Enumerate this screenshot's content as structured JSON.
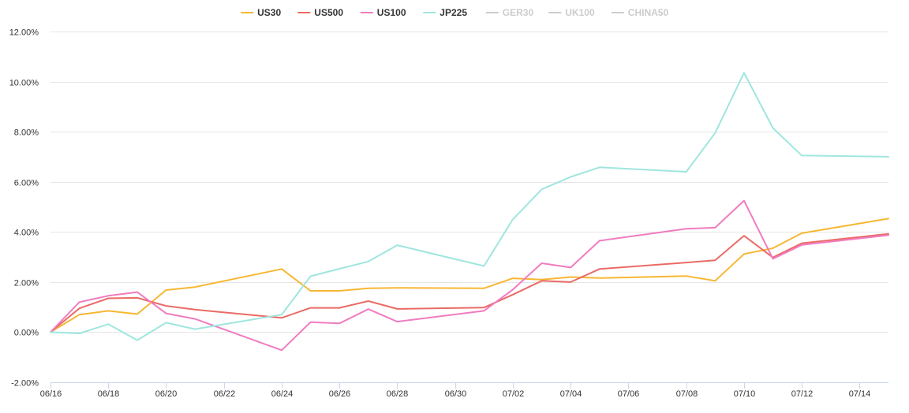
{
  "chart_data": {
    "type": "line",
    "title": "",
    "xlabel": "",
    "ylabel": "",
    "ylim": [
      -2,
      12
    ],
    "yticks": [
      -2,
      0,
      2,
      4,
      6,
      8,
      10,
      12
    ],
    "ytick_labels": [
      "-2.00%",
      "0.00%",
      "2.00%",
      "4.00%",
      "6.00%",
      "8.00%",
      "10.00%",
      "12.00%"
    ],
    "xlim": [
      "2021-06-16",
      "2021-07-15"
    ],
    "xticks": [
      "2021-06-16",
      "2021-06-18",
      "2021-06-20",
      "2021-06-22",
      "2021-06-24",
      "2021-06-26",
      "2021-06-28",
      "2021-06-30",
      "2021-07-02",
      "2021-07-04",
      "2021-07-06",
      "2021-07-08",
      "2021-07-10",
      "2021-07-12",
      "2021-07-14"
    ],
    "xtick_labels": [
      "06/16",
      "06/18",
      "06/20",
      "06/22",
      "06/24",
      "06/26",
      "06/28",
      "06/30",
      "07/02",
      "07/04",
      "07/06",
      "07/08",
      "07/10",
      "07/12",
      "07/14"
    ],
    "grid": true,
    "legend_position": "top",
    "x": [
      "2021-06-16",
      "2021-06-17",
      "2021-06-18",
      "2021-06-19",
      "2021-06-20",
      "2021-06-21",
      "2021-06-24",
      "2021-06-25",
      "2021-06-26",
      "2021-06-27",
      "2021-06-28",
      "2021-07-01",
      "2021-07-02",
      "2021-07-03",
      "2021-07-04",
      "2021-07-05",
      "2021-07-08",
      "2021-07-09",
      "2021-07-10",
      "2021-07-11",
      "2021-07-12",
      "2021-07-15"
    ],
    "series": [
      {
        "name": "US30",
        "color": "#f7b733",
        "visible": true,
        "values": [
          0.0,
          0.7,
          0.85,
          0.72,
          1.68,
          1.8,
          2.52,
          1.65,
          1.65,
          1.75,
          1.77,
          1.75,
          2.15,
          2.1,
          2.2,
          2.16,
          2.24,
          2.05,
          3.12,
          3.35,
          3.95,
          4.53
        ]
      },
      {
        "name": "US500",
        "color": "#ea6b66",
        "visible": true,
        "values": [
          0.0,
          0.95,
          1.35,
          1.37,
          1.05,
          0.9,
          0.57,
          0.97,
          0.97,
          1.24,
          0.93,
          0.98,
          1.5,
          2.05,
          2.0,
          2.52,
          2.78,
          2.87,
          3.85,
          2.98,
          3.55,
          3.92
        ]
      },
      {
        "name": "US100",
        "color": "#f07cc0",
        "visible": true,
        "values": [
          0.0,
          1.2,
          1.45,
          1.6,
          0.75,
          0.53,
          -0.72,
          0.4,
          0.35,
          0.92,
          0.42,
          0.85,
          1.7,
          2.75,
          2.58,
          3.65,
          4.13,
          4.17,
          5.25,
          2.93,
          3.48,
          3.87
        ]
      },
      {
        "name": "JP225",
        "color": "#9fe6de",
        "visible": true,
        "values": [
          0.0,
          -0.05,
          0.32,
          -0.32,
          0.38,
          0.12,
          0.7,
          2.23,
          2.53,
          2.82,
          3.47,
          2.64,
          4.5,
          5.7,
          6.2,
          6.58,
          6.4,
          7.95,
          10.35,
          8.15,
          7.05,
          7.0
        ]
      },
      {
        "name": "GER30",
        "color": "#cccccc",
        "visible": false,
        "values": []
      },
      {
        "name": "UK100",
        "color": "#cccccc",
        "visible": false,
        "values": []
      },
      {
        "name": "CHINA50",
        "color": "#cccccc",
        "visible": false,
        "values": []
      }
    ]
  }
}
